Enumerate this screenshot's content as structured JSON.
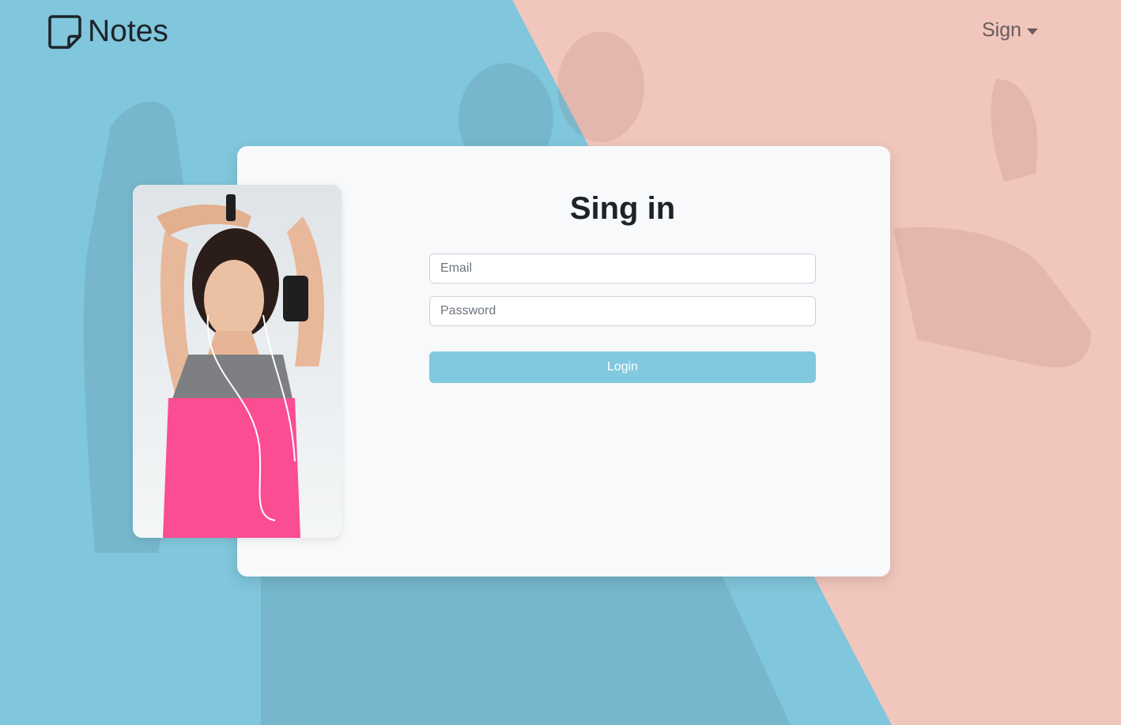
{
  "brand": {
    "name": "Notes",
    "icon": "sticky-note-icon"
  },
  "nav": {
    "sign_label": "Sign",
    "caret_icon": "caret-down-icon"
  },
  "form": {
    "title": "Sing in",
    "email_placeholder": "Email",
    "email_value": "",
    "password_placeholder": "Password",
    "password_value": "",
    "login_label": "Login"
  },
  "colors": {
    "background_blue": "#80c6dc",
    "background_pink": "#f1c6bc",
    "button": "#80c9de",
    "card": "#f7f9fb"
  }
}
